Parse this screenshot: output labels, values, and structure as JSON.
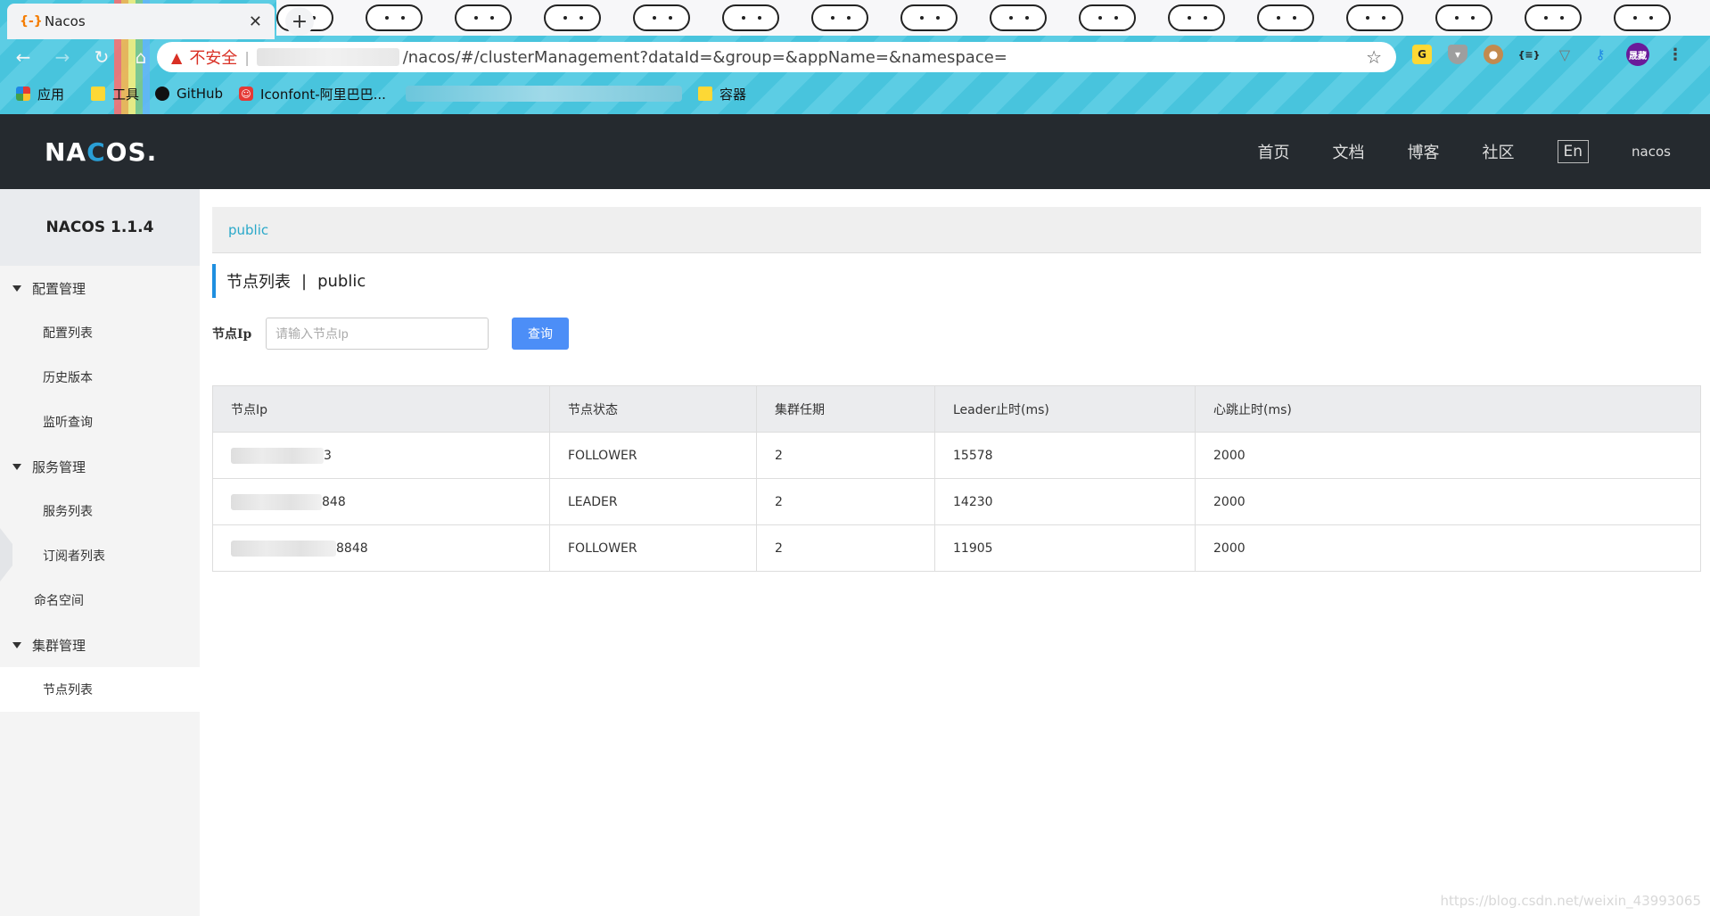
{
  "browser": {
    "tab_title": "Nacos",
    "tab_favicon": "{-}",
    "not_secure_label": "不安全",
    "url_path": "/nacos/#/clusterManagement?dataId=&group=&appName=&namespace=",
    "ext_avatar_text": "晟藏",
    "bookmarks": [
      {
        "label": "应用",
        "icon": "apps-icon"
      },
      {
        "label": "工具",
        "icon": "folder-icon"
      },
      {
        "label": "GitHub",
        "icon": "github-icon"
      },
      {
        "label": "Iconfont-阿里巴巴...",
        "icon": "iconfont-icon"
      },
      {
        "label": "容器",
        "icon": "folder-icon"
      }
    ]
  },
  "header": {
    "logo_text": "NACOS.",
    "nav": [
      "首页",
      "文档",
      "博客",
      "社区"
    ],
    "lang": "En",
    "user": "nacos"
  },
  "sidebar": {
    "title": "NACOS 1.1.4",
    "groups": [
      {
        "label": "配置管理",
        "items": [
          "配置列表",
          "历史版本",
          "监听查询"
        ]
      },
      {
        "label": "服务管理",
        "items": [
          "服务列表",
          "订阅者列表"
        ]
      }
    ],
    "namespace_item": "命名空间",
    "cluster_group": {
      "label": "集群管理",
      "items": [
        "节点列表"
      ]
    }
  },
  "main": {
    "namespace_link": "public",
    "title": "节点列表",
    "title_sep": "|",
    "title_ns": "public",
    "search_label": "节点Ip",
    "search_placeholder": "请输入节点Ip",
    "search_value": "",
    "query_label": "查询",
    "table": {
      "headers": [
        "节点Ip",
        "节点状态",
        "集群任期",
        "Leader止时(ms)",
        "心跳止时(ms)"
      ],
      "rows": [
        {
          "ip_suffix": "3",
          "state": "FOLLOWER",
          "term": "2",
          "leader_due": "15578",
          "heartbeat_due": "2000"
        },
        {
          "ip_suffix": "848",
          "state": "LEADER",
          "term": "2",
          "leader_due": "14230",
          "heartbeat_due": "2000"
        },
        {
          "ip_suffix": "8848",
          "state": "FOLLOWER",
          "term": "2",
          "leader_due": "11905",
          "heartbeat_due": "2000"
        }
      ]
    }
  },
  "watermark": "https://blog.csdn.net/weixin_43993065",
  "colors": {
    "header_bg": "#252a2f",
    "accent_blue": "#4c8ef7",
    "title_bar": "#1f8fe0",
    "ns_link": "#2aa8c9"
  }
}
